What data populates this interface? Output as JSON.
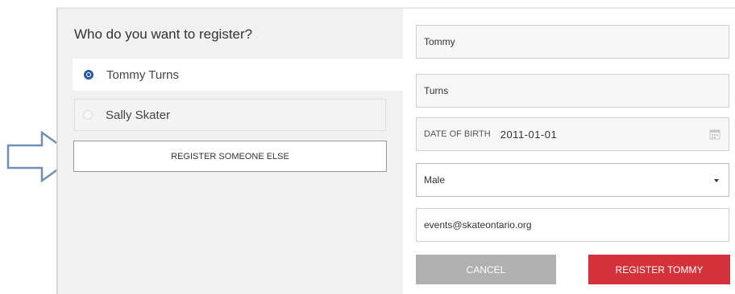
{
  "left_panel": {
    "heading": "Who do you want to register?",
    "options": [
      {
        "label": "Tommy Turns",
        "selected": true
      },
      {
        "label": "Sally Skater",
        "selected": false
      }
    ],
    "register_else_label": "REGISTER SOMEONE ELSE"
  },
  "form": {
    "first_name": "Tommy",
    "last_name": "Turns",
    "dob_label": "DATE OF BIRTH",
    "dob_value": "2011-01-01",
    "gender": "Male",
    "email": "events@skateontario.org",
    "cancel_label": "CANCEL",
    "submit_label": "REGISTER TOMMY"
  },
  "colors": {
    "accent_red": "#d4323a",
    "radio_blue": "#2a5aa8",
    "cancel_gray": "#b0b0b0",
    "arrow_outline": "#6d8fb8"
  },
  "icons": {
    "calendar": "calendar-icon",
    "dropdown": "caret-down-icon",
    "pointer": "right-arrow-icon"
  }
}
